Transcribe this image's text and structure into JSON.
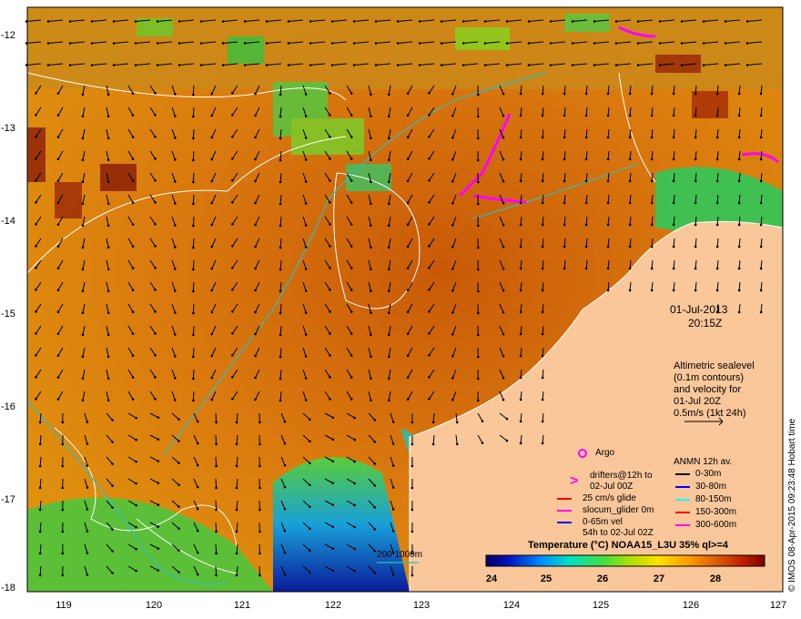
{
  "y_ticks": [
    "-12",
    "-13",
    "-14",
    "-15",
    "-16",
    "-17",
    "-18"
  ],
  "x_ticks": [
    "119",
    "120",
    "121",
    "122",
    "123",
    "124",
    "125",
    "126",
    "127"
  ],
  "date": "01-Jul-2013",
  "time": "20:15Z",
  "altimetry_note": [
    "Altimetric sealevel",
    "(0.1m contours)",
    "and velocity for",
    "01-Jul 20Z",
    "0.5m/s (1kt 24h)"
  ],
  "argo_label": "Argo",
  "drifters_label": [
    "drifters@12h to",
    "02-Jul 00Z"
  ],
  "glide_label": "25 cm/s glide",
  "slocum_label": "slocum_glider 0m",
  "vel_label": [
    "0-65m vel",
    "54h to 02-Jul 02Z"
  ],
  "anmn_title": "ANMN 12h av.",
  "anmn_items": [
    {
      "label": "0-30m",
      "color": "#000000"
    },
    {
      "label": "30-80m",
      "color": "#0000ff"
    },
    {
      "label": "80-150m",
      "color": "#00ffff"
    },
    {
      "label": "150-300m",
      "color": "#ff0000"
    },
    {
      "label": "300-600m",
      "color": "#ff00ff"
    }
  ],
  "isobath_label": "200  1000m",
  "colorbar": {
    "title": "Temperature (°C) NOAA15_L3U 35% ql>=4",
    "ticks": [
      "24",
      "25",
      "26",
      "27",
      "28"
    ],
    "range": [
      23.6,
      28.9
    ]
  },
  "credit": "© IMOS 08-Apr-2015 09:23:48 Hobart time",
  "colors": {
    "land": "#f9c79a",
    "ocean_warm": "#d9700e",
    "coast_cold": "#1c3cc8",
    "drifter": "#ff00ff",
    "isobath": "#2fbfbf",
    "contour": "#ffffff"
  }
}
